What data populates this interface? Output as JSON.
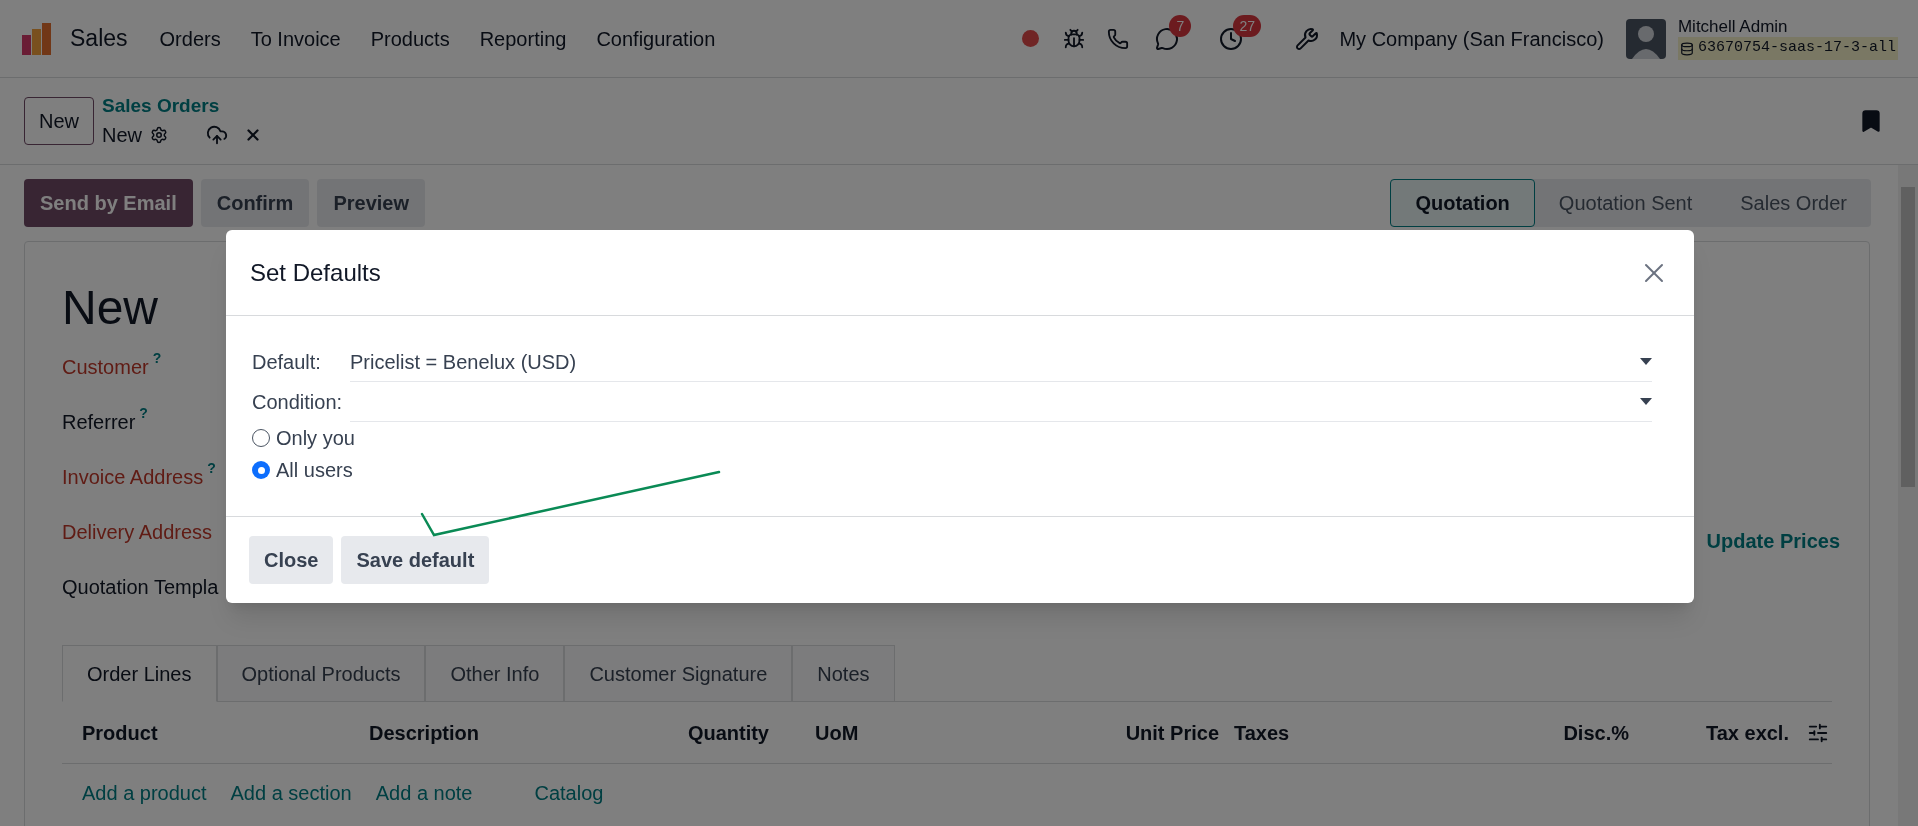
{
  "navbar": {
    "app_name": "Sales",
    "menu": [
      "Orders",
      "To Invoice",
      "Products",
      "Reporting",
      "Configuration"
    ],
    "messages_count": "7",
    "activities_count": "27",
    "company": "My Company (San Francisco)",
    "user_name": "Mitchell Admin",
    "database": "63670754-saas-17-3-all"
  },
  "control_panel": {
    "new_button": "New",
    "breadcrumb": "Sales Orders",
    "record": "New"
  },
  "actions": [
    {
      "label": "Send by Email",
      "kind": "primary"
    },
    {
      "label": "Confirm",
      "kind": "secondary"
    },
    {
      "label": "Preview",
      "kind": "secondary"
    }
  ],
  "status_steps": [
    {
      "label": "Quotation",
      "selected": true
    },
    {
      "label": "Quotation Sent",
      "selected": false
    },
    {
      "label": "Sales Order",
      "selected": false
    }
  ],
  "form": {
    "title": "New",
    "fields": [
      {
        "label": "Customer",
        "help": "?",
        "required": true
      },
      {
        "label": "Referrer",
        "help": "?",
        "required": false
      },
      {
        "label": "Invoice Address",
        "help": "?",
        "required": true
      },
      {
        "label": "Delivery Address",
        "required": true
      },
      {
        "label": "Quotation Templa",
        "required": false
      }
    ],
    "update_prices": "Update Prices"
  },
  "tabs": [
    {
      "label": "Order Lines",
      "selected": true
    },
    {
      "label": "Optional Products",
      "selected": false
    },
    {
      "label": "Other Info",
      "selected": false
    },
    {
      "label": "Customer Signature",
      "selected": false
    },
    {
      "label": "Notes",
      "selected": false
    }
  ],
  "columns": [
    "Product",
    "Description",
    "Quantity",
    "UoM",
    "Unit Price",
    "Taxes",
    "Disc.%",
    "Tax excl."
  ],
  "add_links": [
    "Add a product",
    "Add a section",
    "Add a note",
    "Catalog"
  ],
  "dialog": {
    "title": "Set Defaults",
    "default_label": "Default:",
    "default_value": "Pricelist = Benelux (USD)",
    "condition_label": "Condition:",
    "options": [
      {
        "label": "Only you",
        "selected": false
      },
      {
        "label": "All users",
        "selected": true
      }
    ],
    "buttons": [
      "Close",
      "Save default"
    ]
  }
}
